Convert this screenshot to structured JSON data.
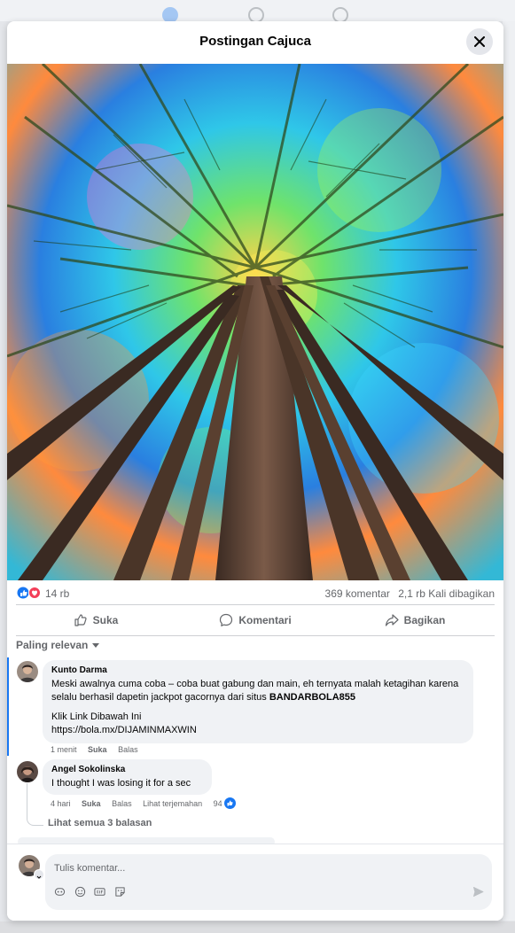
{
  "modal": {
    "title": "Postingan Cajuca"
  },
  "stats": {
    "reaction_count": "14 rb",
    "comments": "369 komentar",
    "shares": "2,1 rb Kali dibagikan"
  },
  "actions": {
    "like": "Suka",
    "comment": "Komentari",
    "share": "Bagikan"
  },
  "sort_label": "Paling relevan",
  "comments": [
    {
      "author": "Kunto Darma",
      "text_before": "Meski awalnya cuma coba – coba buat gabung dan main, eh ternyata malah ketagihan karena selalu berhasil dapetin jackpot gacornya dari situs ",
      "text_bold": "BANDARBOLA855",
      "link_label": "Klik Link Dibawah Ini",
      "link_url": "https://bola.mx/DIJAMINMAXWIN",
      "time": "1 menit",
      "like": "Suka",
      "reply": "Balas"
    },
    {
      "author": "Angel Sokolinska",
      "text": "I thought I was losing it for a sec",
      "time": "4 hari",
      "like": "Suka",
      "reply": "Balas",
      "translate": "Lihat terjemahan",
      "likes": "94"
    }
  ],
  "see_replies": "Lihat semua 3 balasan",
  "composer": {
    "placeholder": "Tulis komentar..."
  },
  "colors": {
    "accent": "#1877f2",
    "love": "#f33e58",
    "bubble": "#f0f2f5"
  }
}
